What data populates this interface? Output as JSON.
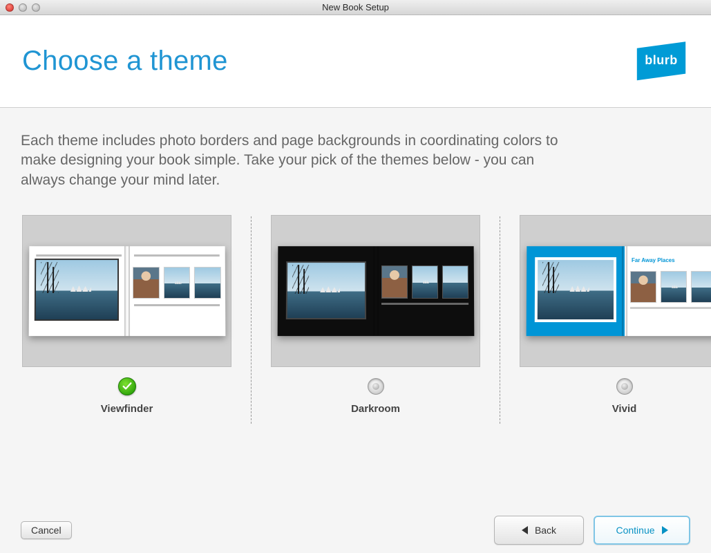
{
  "window": {
    "title": "New Book Setup"
  },
  "header": {
    "title": "Choose a theme",
    "logo_text": "blurb"
  },
  "description": "Each theme includes photo borders and page backgrounds in coordinating colors to make designing your book simple. Take your pick of the themes below - you can always change your mind later.",
  "themes": [
    {
      "name": "Viewfinder",
      "selected": true
    },
    {
      "name": "Darkroom",
      "selected": false
    },
    {
      "name": "Vivid",
      "selected": false,
      "right_page_title": "Far Away Places"
    }
  ],
  "buttons": {
    "cancel": "Cancel",
    "back": "Back",
    "continue": "Continue"
  }
}
